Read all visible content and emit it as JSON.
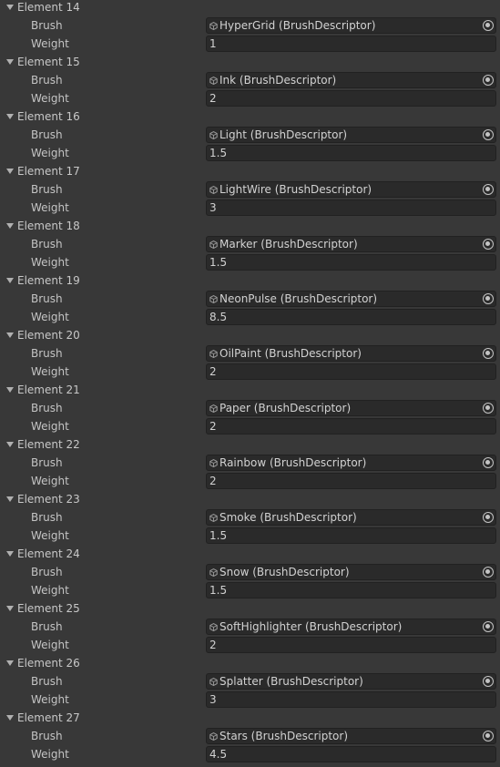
{
  "list": {
    "brush_label": "Brush",
    "weight_label": "Weight",
    "elements": [
      {
        "title": "Element 14",
        "brush": "HyperGrid (BrushDescriptor)",
        "weight": "1"
      },
      {
        "title": "Element 15",
        "brush": "Ink (BrushDescriptor)",
        "weight": "2"
      },
      {
        "title": "Element 16",
        "brush": "Light (BrushDescriptor)",
        "weight": "1.5"
      },
      {
        "title": "Element 17",
        "brush": "LightWire (BrushDescriptor)",
        "weight": "3"
      },
      {
        "title": "Element 18",
        "brush": "Marker (BrushDescriptor)",
        "weight": "1.5"
      },
      {
        "title": "Element 19",
        "brush": "NeonPulse (BrushDescriptor)",
        "weight": "8.5"
      },
      {
        "title": "Element 20",
        "brush": "OilPaint (BrushDescriptor)",
        "weight": "2"
      },
      {
        "title": "Element 21",
        "brush": "Paper (BrushDescriptor)",
        "weight": "2"
      },
      {
        "title": "Element 22",
        "brush": "Rainbow (BrushDescriptor)",
        "weight": "2"
      },
      {
        "title": "Element 23",
        "brush": "Smoke (BrushDescriptor)",
        "weight": "1.5"
      },
      {
        "title": "Element 24",
        "brush": "Snow (BrushDescriptor)",
        "weight": "1.5"
      },
      {
        "title": "Element 25",
        "brush": "SoftHighlighter (BrushDescriptor)",
        "weight": "2"
      },
      {
        "title": "Element 26",
        "brush": "Splatter (BrushDescriptor)",
        "weight": "3"
      },
      {
        "title": "Element 27",
        "brush": "Stars (BrushDescriptor)",
        "weight": "4.5"
      }
    ]
  },
  "icons": {
    "foldout": "foldout-expanded-icon",
    "asset": "scriptable-object-icon",
    "picker": "object-picker-icon"
  },
  "colors": {
    "background": "#383838",
    "field_background": "#2a2a2a",
    "text": "#c4c4c4"
  }
}
